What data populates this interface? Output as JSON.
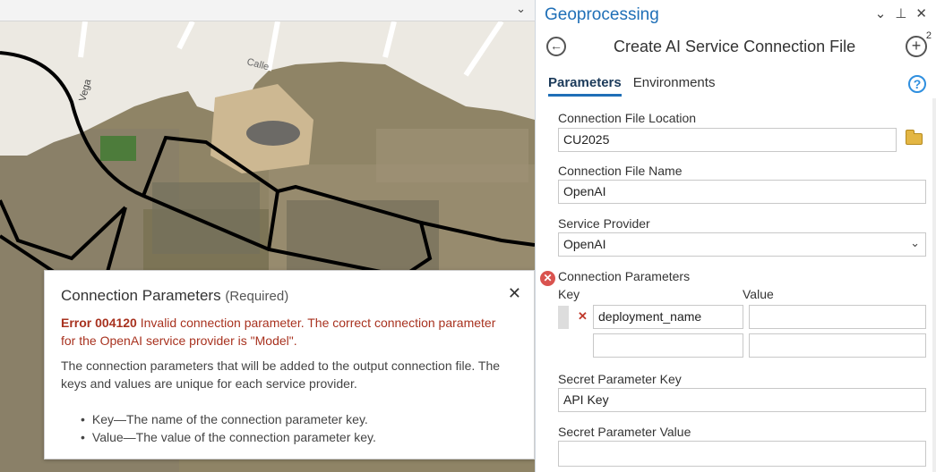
{
  "map": {
    "street_label_1": "Calle",
    "street_label_2": "Vega"
  },
  "popup": {
    "title": "Connection Parameters",
    "title_suffix": "(Required)",
    "error_code": "Error 004120",
    "error_message": "Invalid connection parameter. The correct connection parameter for the OpenAI service provider is \"Model\".",
    "description": "The connection parameters that will be added to the output connection file. The keys and values are unique for each service provider.",
    "bullets": [
      "Key—The name of the connection parameter key.",
      "Value—The value of the connection parameter key."
    ]
  },
  "gp": {
    "pane_title": "Geoprocessing",
    "tool_title": "Create AI Service Connection File",
    "add_badge": "2",
    "tabs": [
      {
        "label": "Parameters",
        "active": true
      },
      {
        "label": "Environments",
        "active": false
      }
    ],
    "params": {
      "file_location_label": "Connection File Location",
      "file_location_value": "CU2025",
      "file_name_label": "Connection File Name",
      "file_name_value": "OpenAI",
      "provider_label": "Service Provider",
      "provider_value": "OpenAI",
      "conn_params_label": "Connection Parameters",
      "key_header": "Key",
      "value_header": "Value",
      "rows": [
        {
          "key": "deployment_name",
          "value": ""
        },
        {
          "key": "",
          "value": ""
        }
      ],
      "secret_key_label": "Secret Parameter Key",
      "secret_key_value": "API Key",
      "secret_value_label": "Secret Parameter Value",
      "secret_value_value": ""
    }
  },
  "icons": {
    "pane_dropdown": "chevron-down-icon",
    "pin": "pin-icon",
    "close": "close-icon",
    "back": "back-arrow-icon",
    "add": "add-icon",
    "help": "help-icon",
    "folder": "folder-icon",
    "error": "error-icon",
    "remove_row": "remove-row-icon"
  },
  "colors": {
    "accent": "#1f6fb7",
    "error": "#a8321f",
    "folder": "#e3b644"
  }
}
